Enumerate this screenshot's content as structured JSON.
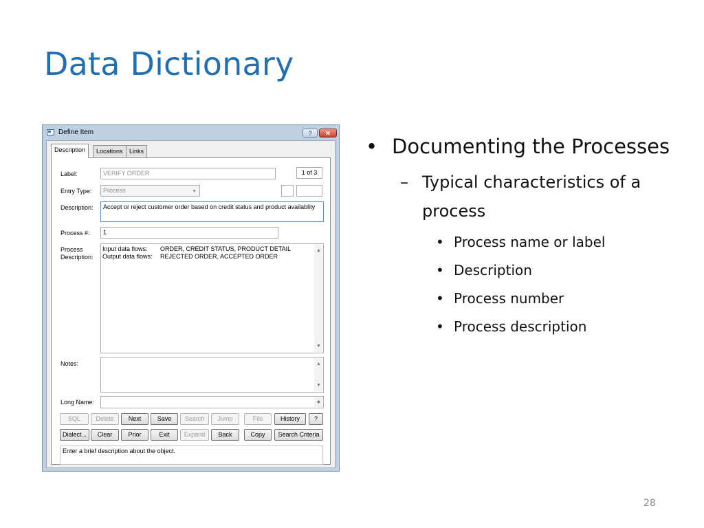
{
  "slide": {
    "title": "Data Dictionary",
    "number": "28",
    "bullets": {
      "level1": "Documenting the Processes",
      "level2": "Typical characteristics of a process",
      "level3": [
        "Process name or label",
        "Description",
        "Process number",
        "Process description"
      ]
    }
  },
  "dialog": {
    "title": "Define Item",
    "help_glyph": "?",
    "close_glyph": "✕",
    "tabs": [
      "Description",
      "Locations",
      "Links"
    ],
    "labels": {
      "label": "Label:",
      "entry_type": "Entry Type:",
      "description": "Description:",
      "process_num": "Process #:",
      "process_desc_1": "Process",
      "process_desc_2": "Description:",
      "notes": "Notes:",
      "long_name": "Long Name:"
    },
    "values": {
      "label": "VERIFY ORDER",
      "counter": "1 of 3",
      "entry_type": "Process",
      "description": "Accept or reject customer order based on credit status and product availablity",
      "process_num": "1",
      "input_flows_key": "Input data flows:",
      "input_flows": "ORDER, CREDIT STATUS, PRODUCT DETAIL",
      "output_flows_key": "Output data flows:",
      "output_flows": "REJECTED ORDER, ACCEPTED ORDER",
      "notes": "",
      "long_name": ""
    },
    "buttons_row1": [
      "SQL",
      "Delete",
      "Next",
      "Save",
      "Search",
      "Jump",
      "File",
      "History",
      "?"
    ],
    "buttons_row2": [
      "Dialect...",
      "Clear",
      "Prior",
      "Exit",
      "Expand",
      "Back",
      "Copy",
      "Search Criteria"
    ],
    "hint": "Enter a brief description about the object."
  },
  "icons": {
    "scroll_up": "▲",
    "scroll_down": "▼",
    "combo": "▼"
  }
}
